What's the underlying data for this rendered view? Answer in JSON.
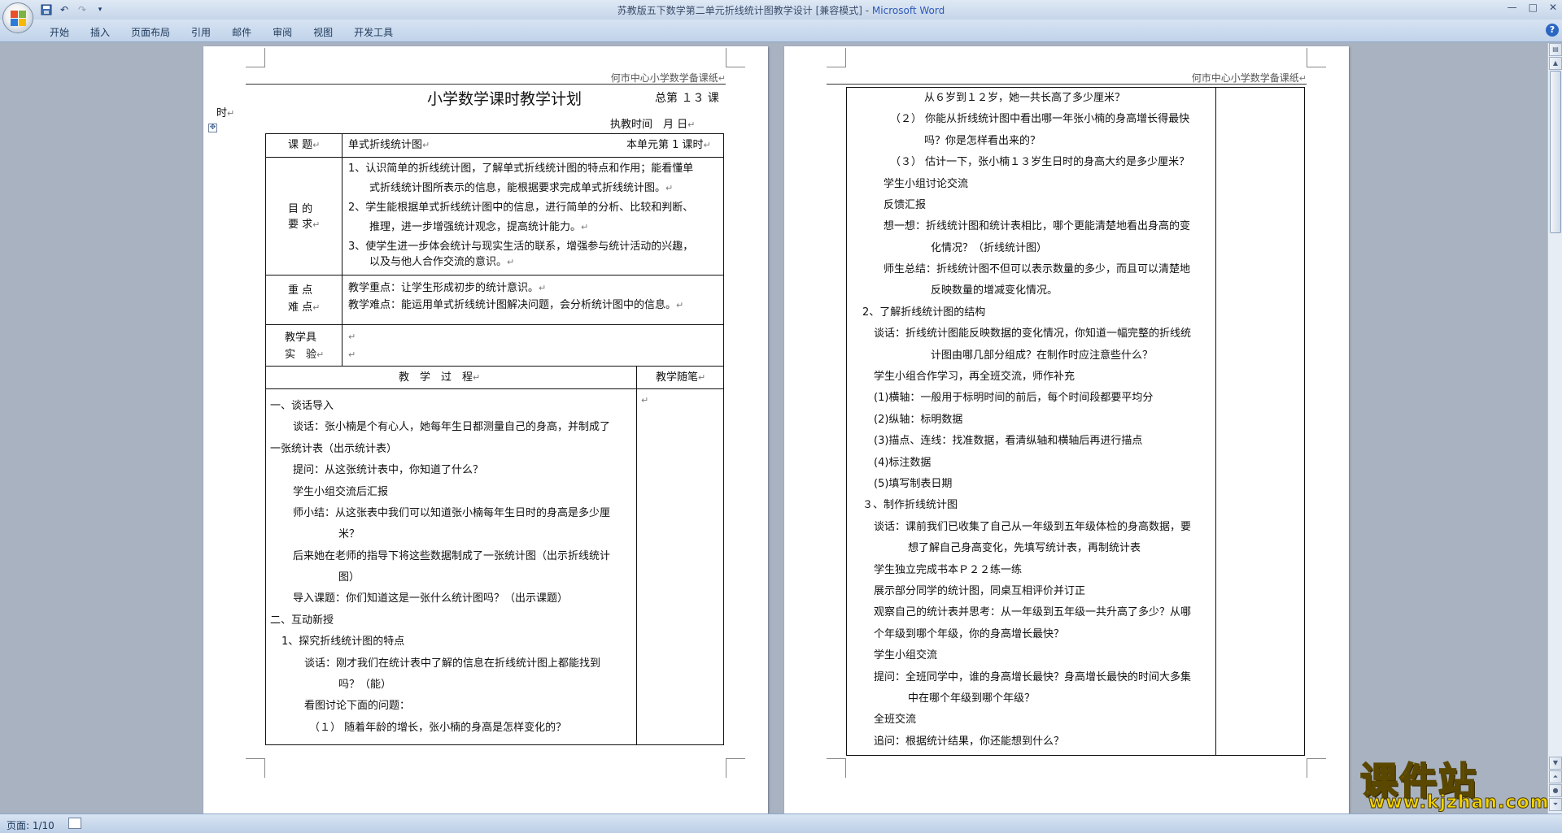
{
  "window": {
    "title": "苏教版五下数学第二单元折线统计图教学设计 [兼容模式] - ",
    "app": "Microsoft Word"
  },
  "ribbon": {
    "tabs": [
      "开始",
      "插入",
      "页面布局",
      "引用",
      "邮件",
      "审阅",
      "视图",
      "开发工具"
    ]
  },
  "status": {
    "pages": "页面: 1/10"
  },
  "page1": {
    "header": "何市中心小学数学备课纸",
    "title": "小学数学课时教学计划",
    "total": "总第 １３ 课",
    "shi": "时",
    "exec_time": "执教时间　月 日",
    "topic_label": "课 题",
    "topic": "单式折线统计图",
    "unit_hour": "本单元第 1 课时",
    "goal_label1": "目 的",
    "goal_label2": "要 求",
    "goals": [
      "1、认识简单的折线统计图，了解单式折线统计图的特点和作用；能看懂单",
      "式折线统计图所表示的信息，能根据要求完成单式折线统计图。",
      "2、学生能根据单式折线统计图中的信息，进行简单的分析、比较和判断、",
      "推理，进一步增强统计观念，提高统计能力。",
      "3、使学生进一步体会统计与现实生活的联系，增强参与统计活动的兴趣，",
      "以及与他人合作交流的意识。"
    ],
    "key_label1": "重 点",
    "key_label2": "难 点",
    "key_point": "教学重点：让学生形成初步的统计意识。",
    "difficult_point": "教学难点：能运用单式折线统计图解决问题，会分析统计图中的信息。",
    "tool_label1": "教学具",
    "tool_label2": "实　验",
    "process_label": "教　学　过　程",
    "notes_label": "教学随笔",
    "process": [
      "一、谈话导入",
      "谈话：张小楠是个有心人，她每年生日都测量自己的身高，并制成了",
      "一张统计表（出示统计表）",
      "提问：从这张统计表中，你知道了什么？",
      "学生小组交流后汇报",
      "师小结：从这张表中我们可以知道张小楠每年生日时的身高是多少厘",
      "米？",
      "后来她在老师的指导下将这些数据制成了一张统计图（出示折线统计",
      "图）",
      "导入课题：你们知道这是一张什么统计图吗？（出示课题）",
      "二、互动新授",
      "1、探究折线统计图的特点",
      "谈话：刚才我们在统计表中了解的信息在折线统计图上都能找到",
      "吗？（能）",
      "看图讨论下面的问题：",
      "（１） 随着年龄的增长，张小楠的身高是怎样变化的？"
    ]
  },
  "page2": {
    "header": "何市中心小学数学备课纸",
    "lines": [
      "从６岁到１２岁，她一共长高了多少厘米？",
      "（２） 你能从折线统计图中看出哪一年张小楠的身高增长得最快",
      "吗？你是怎样看出来的？",
      "（３） 估计一下，张小楠１３岁生日时的身高大约是多少厘米？",
      "学生小组讨论交流",
      "反馈汇报",
      "想一想：折线统计图和统计表相比，哪个更能清楚地看出身高的变",
      "化情况？（折线统计图）",
      "师生总结：折线统计图不但可以表示数量的多少，而且可以清楚地",
      "反映数量的增减变化情况。",
      "2、了解折线统计图的结构",
      "谈话：折线统计图能反映数据的变化情况，你知道一幅完整的折线统",
      "计图由哪几部分组成？在制作时应注意些什么？",
      "学生小组合作学习，再全班交流，师作补充",
      "(1)横轴：一般用于标明时间的前后，每个时间段都要平均分",
      "(2)纵轴：标明数据",
      "(3)描点、连线：找准数据，看清纵轴和横轴后再进行描点",
      "(4)标注数据",
      "(5)填写制表日期",
      "３、制作折线统计图",
      "谈话：课前我们已收集了自己从一年级到五年级体检的身高数据，要",
      "想了解自己身高变化，先填写统计表，再制统计表",
      "学生独立完成书本Ｐ２２练一练",
      "展示部分同学的统计图，同桌互相评价并订正",
      "观察自己的统计表并思考：从一年级到五年级一共升高了多少？从哪",
      "个年级到哪个年级，你的身高增长最快？",
      "学生小组交流",
      "提问：全班同学中，谁的身高增长最快？身高增长最快的时间大多集",
      "中在哪个年级到哪个年级？",
      "全班交流",
      "追问：根据统计结果，你还能想到什么？"
    ]
  },
  "watermark": {
    "cn": "课件站",
    "url": "www.kjzhan.com"
  }
}
